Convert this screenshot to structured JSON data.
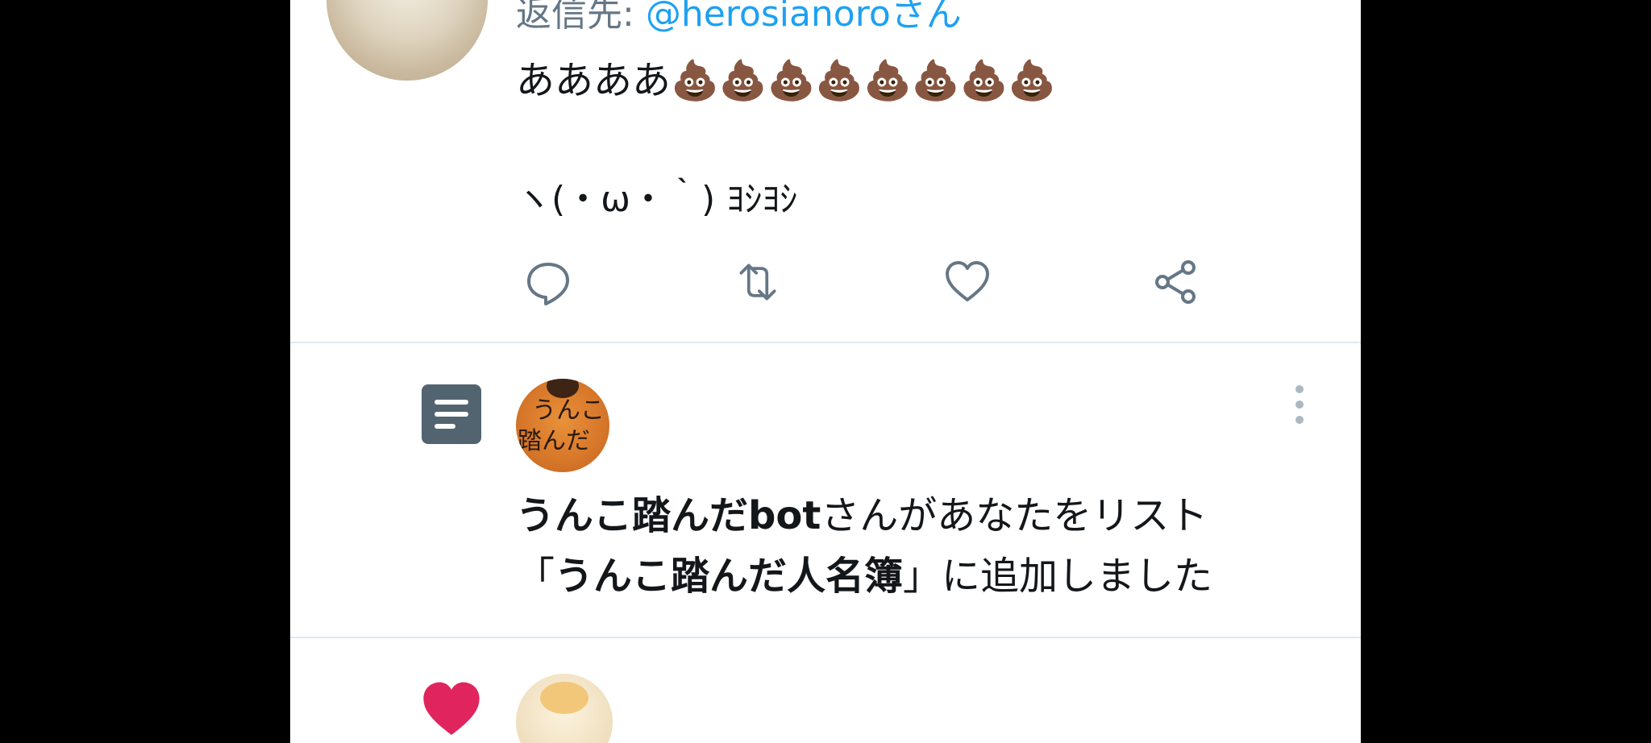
{
  "tweet": {
    "reply_prefix": "返信先: ",
    "reply_handle": "@herosianoroさん",
    "line1": "ああああ💩💩💩💩💩💩💩💩",
    "line2": "ヽ(・ω・｀) ﾖｼﾖｼ"
  },
  "actions": {
    "reply": "reply-icon",
    "retweet": "retweet-icon",
    "like": "heart-outline-icon",
    "share": "share-icon"
  },
  "notification": {
    "actor": "うんこ踏んだbot",
    "text1": "さんがあなたをリスト",
    "open_bracket": "「",
    "list_name": "うんこ踏んだ人名簿",
    "text2": "」に追加しました",
    "avatar_text_1": "うんこ",
    "avatar_text_2": "踏んだ"
  },
  "colors": {
    "accent": "#1da1f2",
    "secondary_text": "#657786",
    "like": "#e0245e",
    "list_icon_bg": "#536471"
  }
}
